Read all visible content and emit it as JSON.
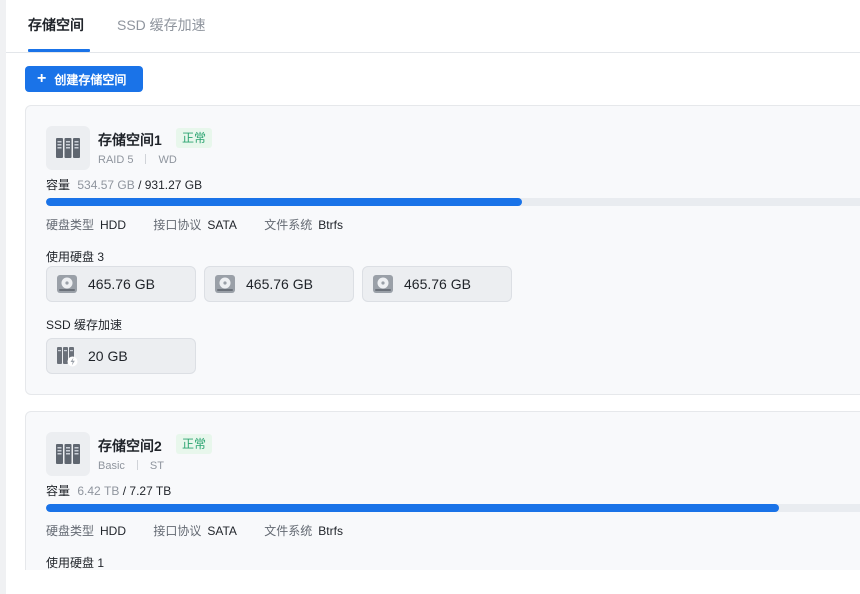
{
  "tabs": [
    {
      "label": "存储空间",
      "active": true
    },
    {
      "label": "SSD 缓存加速",
      "active": false
    }
  ],
  "create_button": {
    "label": "创建存储空间",
    "icon": "plus-icon"
  },
  "labels": {
    "capacity": "容量",
    "disk_type": "硬盘类型",
    "interface": "接口协议",
    "filesystem": "文件系统"
  },
  "colors": {
    "accent": "#1a73e8",
    "status_ok": "#2ba471"
  },
  "pools": [
    {
      "name": "存储空间1",
      "status": "正常",
      "raid": "RAID 5",
      "brand": "WD",
      "capacity_used": "534.57 GB",
      "capacity_total": "/ 931.27 GB",
      "usage_percent": 57.4,
      "disk_type": "HDD",
      "interface": "SATA",
      "filesystem": "Btrfs",
      "disks_label": "使用硬盘 3",
      "disks": [
        "465.76 GB",
        "465.76 GB",
        "465.76 GB"
      ],
      "ssd_label": "SSD 缓存加速",
      "ssd": [
        "20 GB"
      ]
    },
    {
      "name": "存储空间2",
      "status": "正常",
      "raid": "Basic",
      "brand": "ST",
      "capacity_used": "6.42 TB",
      "capacity_total": "/ 7.27 TB",
      "usage_percent": 88.3,
      "disk_type": "HDD",
      "interface": "SATA",
      "filesystem": "Btrfs",
      "disks_label": "使用硬盘 1"
    }
  ]
}
